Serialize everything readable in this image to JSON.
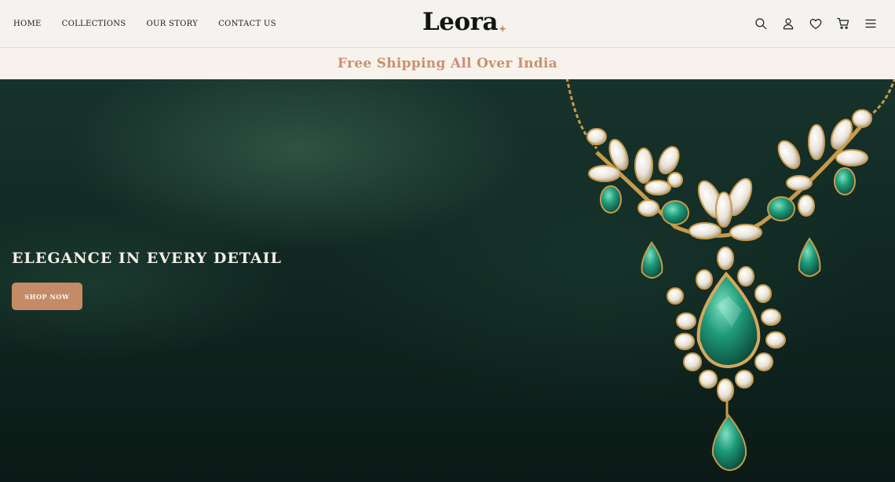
{
  "nav": {
    "links": [
      "HOME",
      "COLLECTIONS",
      "OUR STORY",
      "CONTACT US"
    ],
    "logo": "Leora",
    "logo_mark": "✦",
    "icons": [
      "search-icon",
      "account-icon",
      "wishlist-icon",
      "cart-icon",
      "menu-icon"
    ]
  },
  "announcement": {
    "text": "Free Shipping All Over India"
  },
  "hero": {
    "title": "ELEGANCE IN EVERY DETAIL",
    "button": "SHOP NOW",
    "image_subject": "gold necklace with emerald and white stones"
  },
  "colors": {
    "accent": "#c99171",
    "button": "#c58b67",
    "background": "#f5f3ef",
    "hero_dark": "#112822",
    "emerald": "#1f9b7a"
  }
}
